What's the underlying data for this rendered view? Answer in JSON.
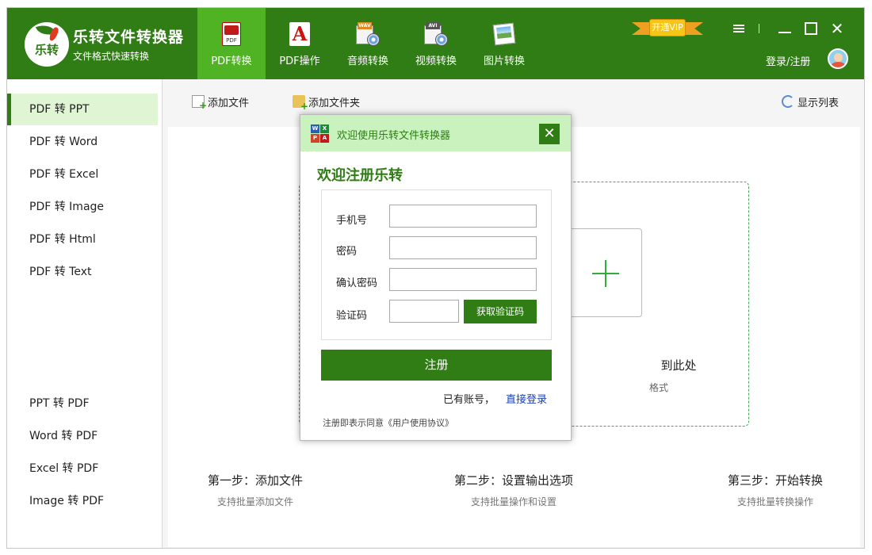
{
  "app": {
    "logo_text": "乐转",
    "title": "乐转文件转换器",
    "subtitle": "文件格式快速转换"
  },
  "nav": {
    "tabs": [
      {
        "label": "PDF转换",
        "icon": "pdf-file-icon",
        "active": true
      },
      {
        "label": "PDF操作",
        "icon": "acrobat-icon",
        "active": false
      },
      {
        "label": "音频转换",
        "icon": "audio-file-icon",
        "tag": "WAV",
        "active": false
      },
      {
        "label": "视频转换",
        "icon": "video-file-icon",
        "tag": "AVI",
        "active": false
      },
      {
        "label": "图片转换",
        "icon": "image-file-icon",
        "active": false
      }
    ]
  },
  "header": {
    "vip_label": "开通VIP",
    "login_label": "登录/注册"
  },
  "sidebar": {
    "items": [
      {
        "label": "PDF 转 PPT",
        "active": true
      },
      {
        "label": "PDF 转 Word"
      },
      {
        "label": "PDF 转 Excel"
      },
      {
        "label": "PDF 转 Image"
      },
      {
        "label": "PDF 转 Html"
      },
      {
        "label": "PDF 转 Text"
      },
      {
        "label": "PPT 转 PDF"
      },
      {
        "label": "Word 转 PDF"
      },
      {
        "label": "Excel 转 PDF"
      },
      {
        "label": "Image 转 PDF"
      }
    ]
  },
  "toolbar": {
    "add_file": "添加文件",
    "add_folder": "添加文件夹",
    "show_list": "显示列表"
  },
  "dropzone": {
    "text": "到此处",
    "hint": "格式"
  },
  "steps": [
    {
      "title": "第一步：添加文件",
      "desc": "支持批量添加文件"
    },
    {
      "title": "第二步：设置输出选项",
      "desc": "支持批量操作和设置"
    },
    {
      "title": "第三步：开始转换",
      "desc": "支持批量转换操作"
    }
  ],
  "modal": {
    "title": "欢迎使用乐转文件转换器",
    "heading": "欢迎注册乐转",
    "phone_label": "手机号",
    "password_label": "密码",
    "confirm_label": "确认密码",
    "captcha_label": "验证码",
    "phone_value": "",
    "password_value": "",
    "confirm_value": "",
    "captcha_value": "",
    "captcha_button": "获取验证码",
    "register_button": "注册",
    "has_account": "已有账号，",
    "direct_login": "直接登录",
    "agreement": "注册即表示同意《用户使用协议》"
  },
  "colors": {
    "header_green": "#2f7d14",
    "active_tab_green": "#4fb324",
    "modal_header": "#c9f2bf",
    "link_blue": "#1a3fb5"
  }
}
